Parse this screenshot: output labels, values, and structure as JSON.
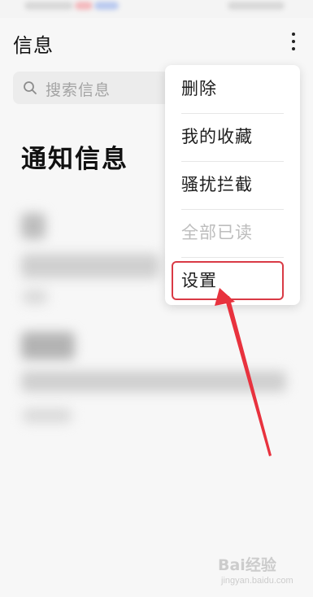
{
  "header": {
    "title": "信息",
    "more_icon": "more-vertical-icon"
  },
  "search": {
    "placeholder": "搜索信息",
    "icon": "search-icon"
  },
  "section": {
    "title": "通知信息"
  },
  "menu": {
    "items": [
      {
        "label": "删除",
        "enabled": true
      },
      {
        "label": "我的收藏",
        "enabled": true
      },
      {
        "label": "骚扰拦截",
        "enabled": true
      },
      {
        "label": "全部已读",
        "enabled": false
      },
      {
        "label": "设置",
        "enabled": true,
        "highlighted": true
      }
    ]
  },
  "annotation": {
    "color": "#e8323e"
  },
  "watermark": {
    "brand": "Bai经验",
    "url": "jingyan.baidu.com"
  },
  "colors": {
    "background": "#f7f7f7",
    "menu_bg": "#ffffff",
    "disabled_text": "#bdbdbd",
    "highlight": "#d93a45"
  }
}
